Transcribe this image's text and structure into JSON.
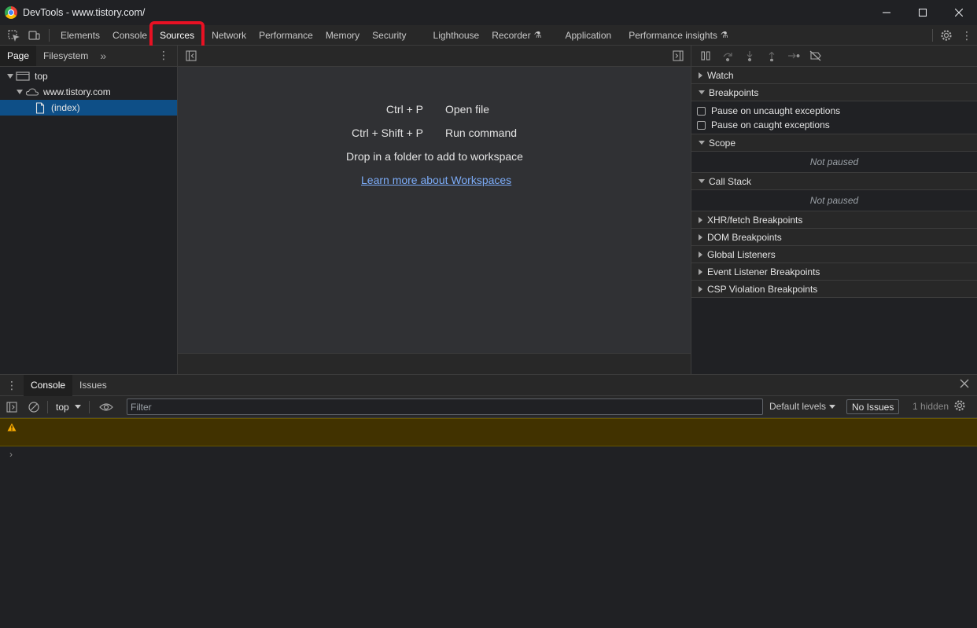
{
  "window": {
    "title": "DevTools - www.tistory.com/"
  },
  "main_tabs": [
    {
      "label": "Elements"
    },
    {
      "label": "Console"
    },
    {
      "label": "Sources"
    },
    {
      "label": "Network"
    },
    {
      "label": "Performance"
    },
    {
      "label": "Memory"
    },
    {
      "label": "Security"
    },
    {
      "label": "Lighthouse"
    },
    {
      "label": "Recorder"
    },
    {
      "label": "Application"
    },
    {
      "label": "Performance insights"
    }
  ],
  "active_tab": "Sources",
  "highlight_color": "#e81123",
  "navigator": {
    "tabs": [
      {
        "label": "Page"
      },
      {
        "label": "Filesystem"
      }
    ],
    "tree": {
      "top": "top",
      "domain": "www.tistory.com",
      "file": "(index)"
    }
  },
  "editor": {
    "shortcuts": [
      {
        "keys": "Ctrl + P",
        "action": "Open file"
      },
      {
        "keys": "Ctrl + Shift + P",
        "action": "Run command"
      }
    ],
    "drop_hint": "Drop in a folder to add to workspace",
    "learn_link": "Learn more about Workspaces"
  },
  "debugger": {
    "watch": "Watch",
    "breakpoints": "Breakpoints",
    "pause_uncaught": "Pause on uncaught exceptions",
    "pause_caught": "Pause on caught exceptions",
    "scope": "Scope",
    "scope_status": "Not paused",
    "call_stack": "Call Stack",
    "call_stack_status": "Not paused",
    "xhr": "XHR/fetch Breakpoints",
    "dom": "DOM Breakpoints",
    "global": "Global Listeners",
    "event": "Event Listener Breakpoints",
    "csp": "CSP Violation Breakpoints"
  },
  "drawer": {
    "tabs": [
      {
        "label": "Console"
      },
      {
        "label": "Issues"
      }
    ],
    "context": "top",
    "filter_placeholder": "Filter",
    "levels": "Default levels",
    "issues": "No Issues",
    "hidden": "1 hidden"
  },
  "colors": {
    "accent_link": "#7cacf8",
    "selection": "#0e4f87",
    "warning_bg": "#413200",
    "warning_icon": "#f9ab00"
  }
}
